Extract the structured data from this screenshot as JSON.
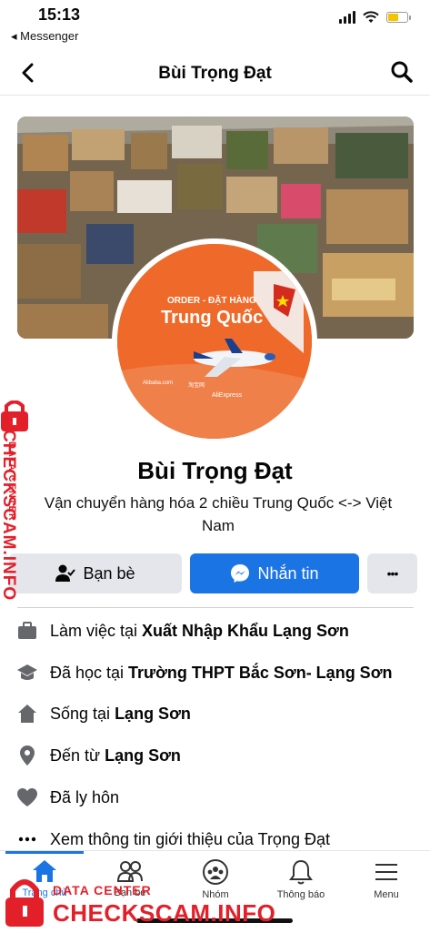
{
  "status": {
    "time": "15:13",
    "back_app": "◂ Messenger"
  },
  "header": {
    "title": "Bùi Trọng Đạt"
  },
  "cover": {
    "avatar_text": {
      "line1": "ORDER - ĐẶT HÀNG",
      "line2": "Trung Quốc",
      "brands": [
        "Alibaba.com",
        "淘宝网",
        "AliExpress"
      ]
    }
  },
  "profile": {
    "name": "Bùi Trọng Đạt",
    "bio": "Vận chuyển hàng hóa 2 chiều Trung Quốc <-> Việt Nam"
  },
  "actions": {
    "friends": "Bạn bè",
    "message": "Nhắn tin",
    "more": "•••"
  },
  "details": [
    {
      "prefix": "Làm việc tại",
      "value": "Xuất Nhập Khẩu Lạng Sơn",
      "icon": "briefcase-icon"
    },
    {
      "prefix": "Đã học tại",
      "value": "Trường THPT Bắc Sơn- Lạng Sơn",
      "icon": "graduation-cap-icon"
    },
    {
      "prefix": "Sống tại",
      "value": "Lạng Sơn",
      "icon": "home-icon"
    },
    {
      "prefix": "Đến từ",
      "value": "Lạng Sơn",
      "icon": "location-pin-icon"
    },
    {
      "prefix": "Đã ly hôn",
      "value": "",
      "icon": "heart-icon"
    },
    {
      "prefix": "Xem thông tin giới thiệu của Trọng Đạt",
      "value": "",
      "icon": "more-dots-icon"
    }
  ],
  "nav": {
    "home": "Trang chủ",
    "friends": "Bạn bè",
    "groups": "Nhóm",
    "notifications": "Thông báo",
    "menu": "Menu"
  },
  "watermark": {
    "line1": "DATA CENTER",
    "line2": "CHECKSCAM.INFO"
  },
  "colors": {
    "accent": "#1b74e4",
    "watermark": "#e3202a",
    "avatar_bg": "#ef6a2a"
  }
}
